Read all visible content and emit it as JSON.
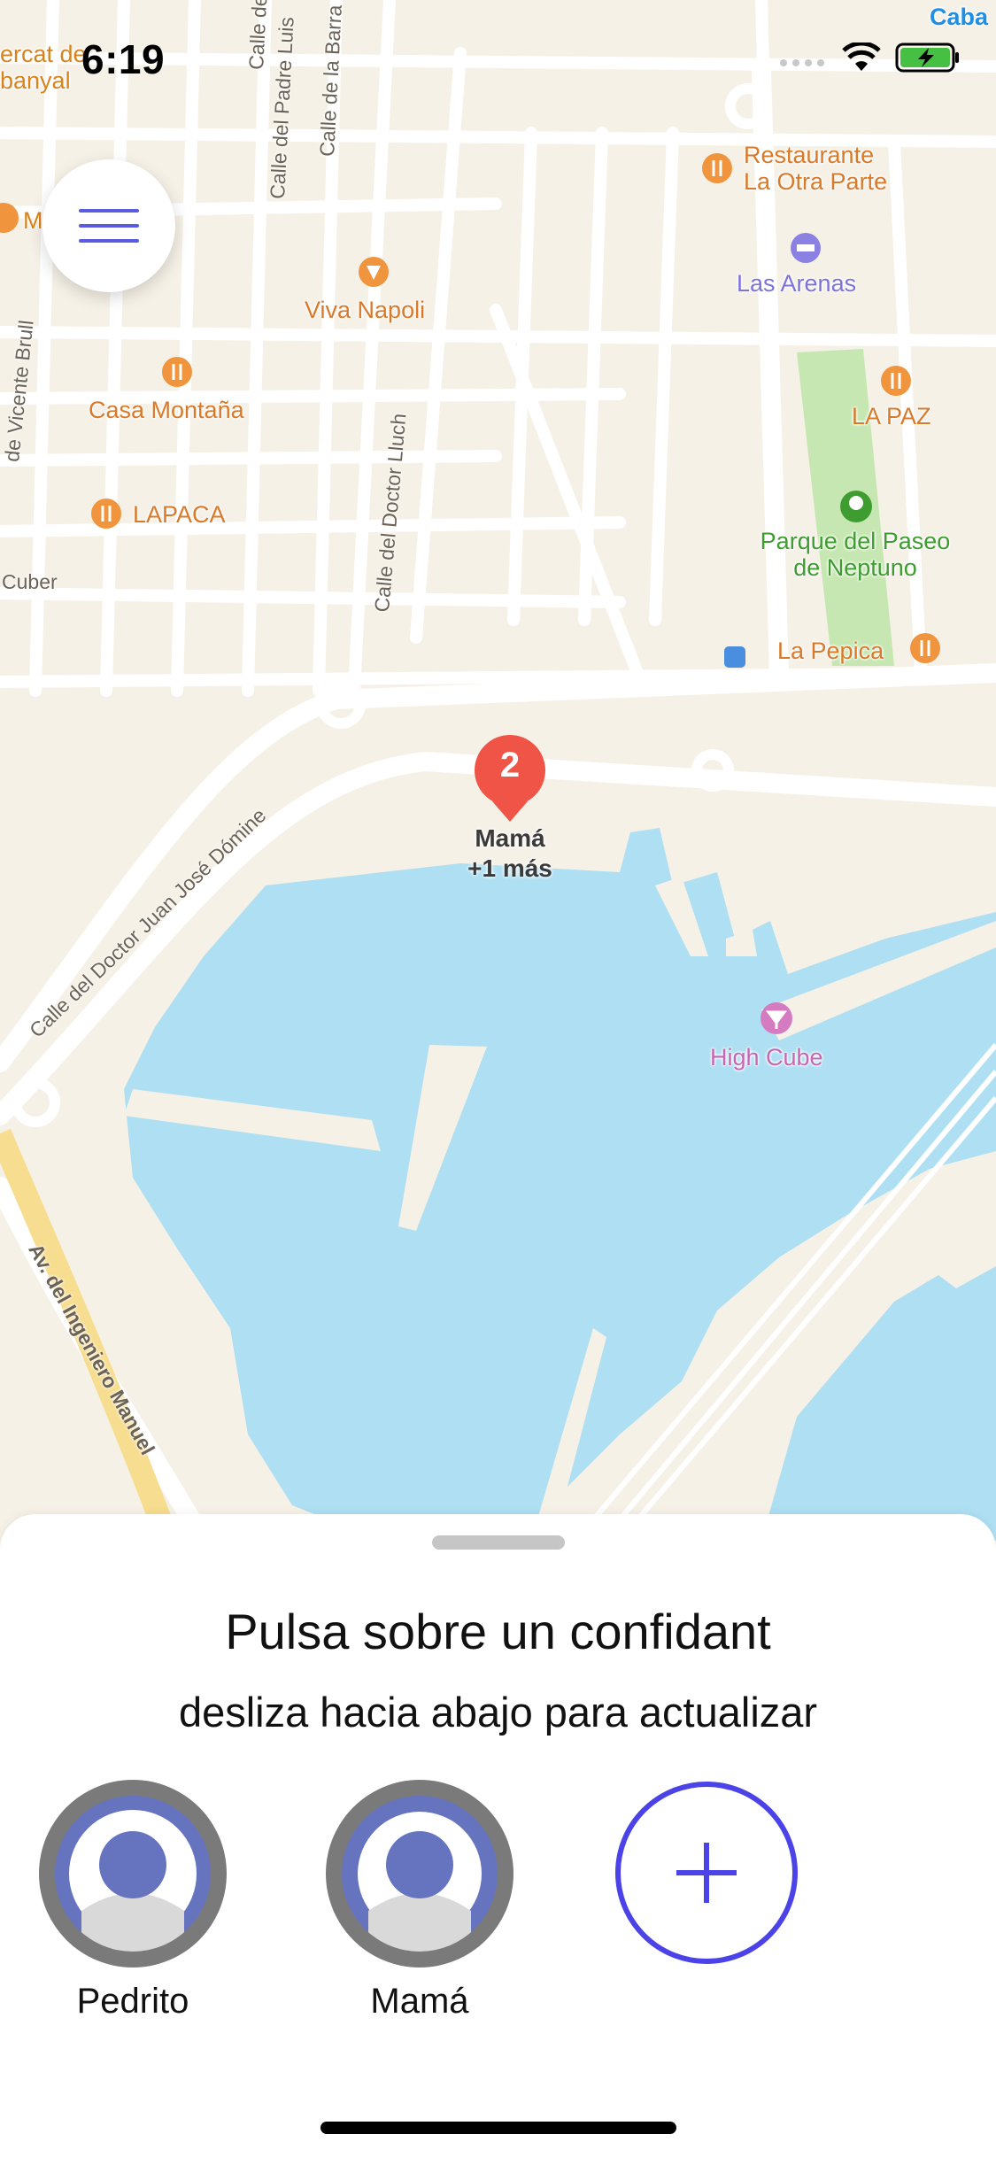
{
  "status_bar": {
    "time": "6:19"
  },
  "map": {
    "cluster": {
      "count": "2",
      "label_primary": "Mamá",
      "label_secondary": "+1 más"
    },
    "pois": {
      "mercat": "ercat de\nbanyal",
      "restaurante": "Restaurante\nLa Otra Parte",
      "las_arenas": "Las Arenas",
      "viva_napoli": "Viva Napoli",
      "casa_montana": "Casa Montaña",
      "la_paz": "LA PAZ",
      "lapaca": "LAPACA",
      "parque": "Parque del Paseo\nde Neptuno",
      "la_pepica": "La Pepica",
      "high_cube": "High Cube",
      "caba": "Caba",
      "m": "M"
    },
    "streets": {
      "padre_luis": "Calle del Padre Luis",
      "la_barra": "Calle de la Barra",
      "calle_de": "Calle de",
      "vicente_brull": "de Vicente Brull",
      "doctor_lluch": "Calle del Doctor Lluch",
      "cuber": "Cuber",
      "juan_jose_domine": "Calle del Doctor Juan José Dómine",
      "ingeniero_manuel": "Av. del Ingeniero Manuel"
    },
    "colors": {
      "land": "#f6f1e7",
      "water": "#aedff2",
      "park": "#c6e7b1",
      "restaurant": "#f0943d",
      "hotel": "#8b81e2",
      "park_label": "#3e9c30",
      "nightlife": "#d47bc2",
      "pin": "#f05446"
    }
  },
  "sheet": {
    "title": "Pulsa sobre un confidant",
    "subtitle": "desliza hacia abajo para actualizar",
    "confidants": [
      {
        "name": "Pedrito"
      },
      {
        "name": "Mamá"
      }
    ],
    "add_icon": "plus-icon",
    "accent_color": "#4b43e8"
  }
}
